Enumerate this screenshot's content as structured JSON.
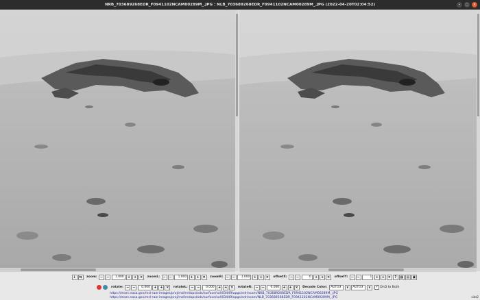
{
  "window": {
    "title": "NRB_703689268EDR_F0941102NCAM00289M_.JPG : NLB_703689268EDR_F0941102NCAM00289M_.JPG (2022-04-20T02:04:52)",
    "minimize": "–",
    "maximize": "□",
    "close": "×"
  },
  "controls": {
    "zoom": {
      "label": "zoom:",
      "value": "1.000"
    },
    "zoomL": {
      "label": "zoomL:",
      "value": "1.000"
    },
    "zoomR": {
      "label": "zoomR:",
      "value": "1.000"
    },
    "offsetX": {
      "label": "offsetX:",
      "value": "0"
    },
    "offsetY": {
      "label": "offsetY:",
      "value": "1"
    },
    "rotate": {
      "label": "rotate:",
      "value": "0.000"
    },
    "rotateL": {
      "label": "rotateL:",
      "value": "0.000"
    },
    "rotateR": {
      "label": "rotateR:",
      "value": "0.000"
    },
    "decode_color": {
      "label": "Decode Color:",
      "left": "AUTO3",
      "right": "AUTO3"
    },
    "dnd": {
      "label": "DnD to Both",
      "checked": "✓"
    }
  },
  "buttons": {
    "minus": "−",
    "plus": "+",
    "reset": "×",
    "dec": "−",
    "inc": "+"
  },
  "links": {
    "left_url": "https://mars.nasa.gov/msl-raw-images/proj/msl/redops/ods/surface/sol/03449/opgs/edr/ncam/NRB_703689268EDR_F0941102NCAM00289M_.JPG",
    "right_url": "https://mars.nasa.gov/msl-raw-images/proj/msl/redops/ods/surface/sol/03449/opgs/edr/ncam/NLB_703689268EDR_F0941102NCAM00289M_.JPG"
  },
  "corner_text": "sibt2",
  "colors": {
    "titlebar": "#2c2c2c",
    "close": "#e0562e",
    "link": "#2a2aa8"
  }
}
